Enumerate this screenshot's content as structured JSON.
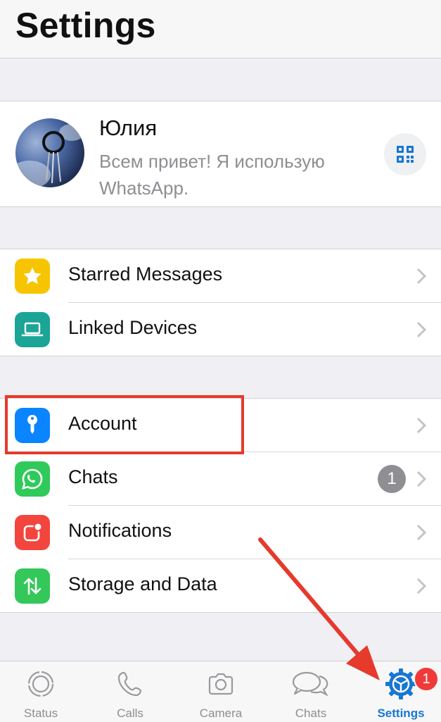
{
  "header": {
    "title": "Settings"
  },
  "profile": {
    "name": "Юлия",
    "status": "Всем привет! Я использую WhatsApp."
  },
  "group1": [
    {
      "label": "Starred Messages",
      "icon": "star-icon",
      "color": "#f7c500"
    },
    {
      "label": "Linked Devices",
      "icon": "laptop-icon",
      "color": "#1aa597"
    }
  ],
  "group2": [
    {
      "label": "Account",
      "icon": "key-icon",
      "color": "#0a84ff"
    },
    {
      "label": "Chats",
      "icon": "whatsapp-icon",
      "color": "#2fca5a",
      "badge": "1"
    },
    {
      "label": "Notifications",
      "icon": "notification-icon",
      "color": "#f2453d"
    },
    {
      "label": "Storage and Data",
      "icon": "arrows-updown-icon",
      "color": "#34c759"
    }
  ],
  "tabbar": {
    "tabs": [
      {
        "label": "Status",
        "icon": "status-icon"
      },
      {
        "label": "Calls",
        "icon": "phone-icon"
      },
      {
        "label": "Camera",
        "icon": "camera-icon"
      },
      {
        "label": "Chats",
        "icon": "chat-bubbles-icon"
      },
      {
        "label": "Settings",
        "icon": "settings-gear-icon",
        "active": true
      }
    ],
    "settings_badge": "1"
  },
  "colors": {
    "accent": "#1877d2",
    "highlight": "#e53a2c"
  }
}
